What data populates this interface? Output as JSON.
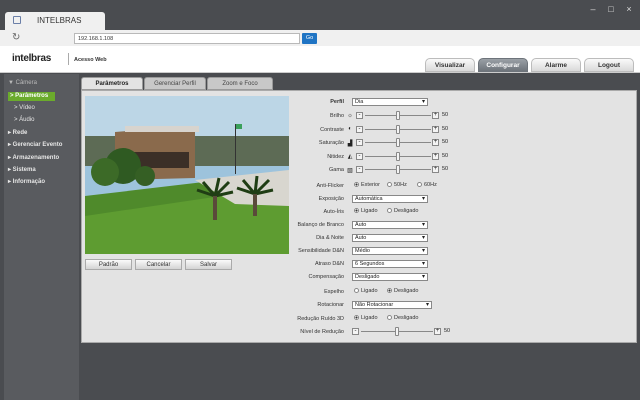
{
  "browser": {
    "tab_title": "INTELBRAS",
    "url": "192.168.1.108",
    "go_label": "Go",
    "window_buttons": [
      "–",
      "□",
      "×"
    ]
  },
  "header": {
    "logo": "intelbras",
    "subtitle": "Acesso Web",
    "nav": [
      "Visualizar",
      "Configurar",
      "Alarme",
      "Logout"
    ]
  },
  "sidebar": {
    "items": [
      {
        "label": "▼ Câmera"
      },
      {
        "label": "> Parâmetros"
      },
      {
        "label": "> Vídeo"
      },
      {
        "label": "> Áudio"
      },
      {
        "label": "▸ Rede"
      },
      {
        "label": "▸ Gerenciar Evento"
      },
      {
        "label": "▸ Armazenamento"
      },
      {
        "label": "▸ Sistema"
      },
      {
        "label": "▸ Informação"
      }
    ]
  },
  "tabs": [
    "Parâmetros",
    "Gerenciar Perfil",
    "Zoom e Foco"
  ],
  "video_buttons": [
    "Padrão",
    "Cancelar",
    "Salvar"
  ],
  "form": {
    "perfil_label": "Perfil",
    "perfil_value": "Dia",
    "sliders": [
      {
        "label": "Brilho",
        "icon": "brightness-icon",
        "value": "50",
        "level": 0.5
      },
      {
        "label": "Contraste",
        "icon": "contrast-icon",
        "value": "50",
        "level": 0.5
      },
      {
        "label": "Saturação",
        "icon": "saturation-icon",
        "value": "50",
        "level": 0.5
      },
      {
        "label": "Nitidez",
        "icon": "sharpness-icon",
        "value": "50",
        "level": 0.5
      },
      {
        "label": "Gama",
        "icon": "gamma-icon",
        "value": "50",
        "level": 0.5
      }
    ],
    "antiflicker": {
      "label": "Anti-Flicker",
      "options": [
        "Exterior",
        "50Hz",
        "60Hz"
      ],
      "selected": 0
    },
    "exposicao": {
      "label": "Exposição",
      "value": "Automática"
    },
    "autoiris": {
      "label": "Auto-Íris",
      "options": [
        "Ligado",
        "Desligado"
      ],
      "selected": 0
    },
    "balanco": {
      "label": "Balanço de Branco",
      "value": "Auto"
    },
    "dianoite": {
      "label": "Dia & Noite",
      "value": "Auto"
    },
    "sensibilidade": {
      "label": "Sensibilidade D&N",
      "value": "Médio"
    },
    "atraso": {
      "label": "Atraso D&N",
      "value": "6 Segundos"
    },
    "compensacao": {
      "label": "Compensação",
      "value": "Desligado"
    },
    "espelho": {
      "label": "Espelho",
      "options": [
        "Ligado",
        "Desligado"
      ],
      "selected": 1
    },
    "rotacionar": {
      "label": "Rotacionar",
      "value": "Não Rotacionar"
    },
    "reducao3d": {
      "label": "Redução Ruído 3D",
      "options": [
        "Ligado",
        "Desligado"
      ],
      "selected": 0
    },
    "nivel": {
      "label": "Nível de Redução",
      "value": "50",
      "level": 0.5
    }
  }
}
